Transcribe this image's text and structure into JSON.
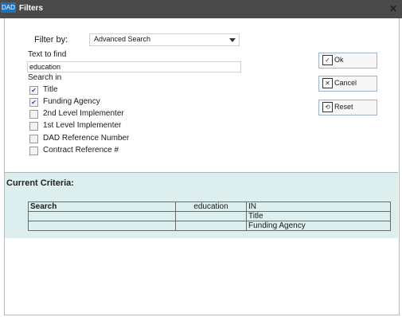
{
  "window": {
    "app_badge": "DAD",
    "title": "Filters",
    "close_glyph": "✕"
  },
  "filter": {
    "label": "Filter by:",
    "selected": "Advanced Search"
  },
  "text_find": {
    "label": "Text to find",
    "value": "education"
  },
  "search_in": {
    "label": "Search in",
    "options": [
      {
        "label": "Title",
        "checked": true
      },
      {
        "label": "Funding Agency",
        "checked": true
      },
      {
        "label": "2nd Level Implementer",
        "checked": false
      },
      {
        "label": "1st Level Implementer",
        "checked": false
      },
      {
        "label": "DAD Reference Number",
        "checked": false
      },
      {
        "label": "Contract Reference #",
        "checked": false
      }
    ]
  },
  "buttons": {
    "ok": "Ok",
    "cancel": "Cancel",
    "reset": "Reset"
  },
  "criteria": {
    "label": "Current Criteria:",
    "rows": [
      [
        "Search",
        "education",
        "IN"
      ],
      [
        "",
        "",
        "Title"
      ],
      [
        "",
        "",
        "Funding Agency"
      ]
    ]
  },
  "icons": {
    "ok": "check-doc-icon",
    "cancel": "cancel-doc-icon",
    "reset": "reset-doc-icon"
  },
  "colors": {
    "titlebar": "#4a4a4a",
    "criteria_bg": "#ddeeee",
    "checkbox_check": "#2b4fa0"
  }
}
